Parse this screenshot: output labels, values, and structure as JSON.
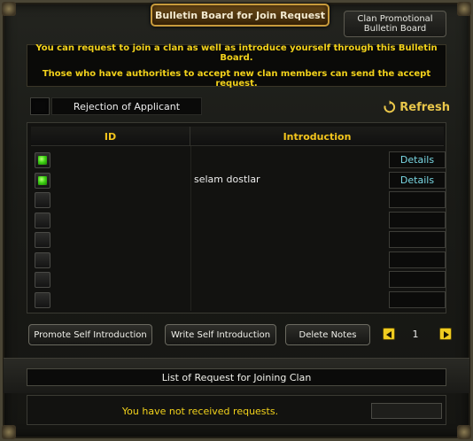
{
  "tabs": {
    "active": "Bulletin Board for Join Request",
    "promo_line1": "Clan Promotional",
    "promo_line2": "Bulletin Board"
  },
  "notice": {
    "line1": "You can request to join a clan as well as introduce yourself through this Bulletin Board.",
    "line2": "Those who have authorities to accept new clan members can send the accept request."
  },
  "reject_label": "Rejection of Applicant",
  "refresh_label": "Refresh",
  "list": {
    "headers": {
      "id": "ID",
      "intro": "Introduction"
    },
    "rows": [
      {
        "checked": true,
        "id": "",
        "intro": "",
        "details": "Details"
      },
      {
        "checked": true,
        "id": "",
        "intro": "selam dostlar",
        "details": "Details"
      },
      {
        "checked": false,
        "id": "",
        "intro": "",
        "details": ""
      },
      {
        "checked": false,
        "id": "",
        "intro": "",
        "details": ""
      },
      {
        "checked": false,
        "id": "",
        "intro": "",
        "details": ""
      },
      {
        "checked": false,
        "id": "",
        "intro": "",
        "details": ""
      },
      {
        "checked": false,
        "id": "",
        "intro": "",
        "details": ""
      },
      {
        "checked": false,
        "id": "",
        "intro": "",
        "details": ""
      }
    ]
  },
  "buttons": {
    "promote": "Promote Self Introduction",
    "write": "Write Self Introduction",
    "delete": "Delete Notes"
  },
  "pagination": {
    "page": "1"
  },
  "requests": {
    "title": "List of Request for Joining Clan",
    "empty_message": "You have not received requests."
  },
  "colors": {
    "accent_gold": "#f2d21b",
    "details_cyan": "#7ad8e4",
    "check_green": "#3fd414"
  }
}
